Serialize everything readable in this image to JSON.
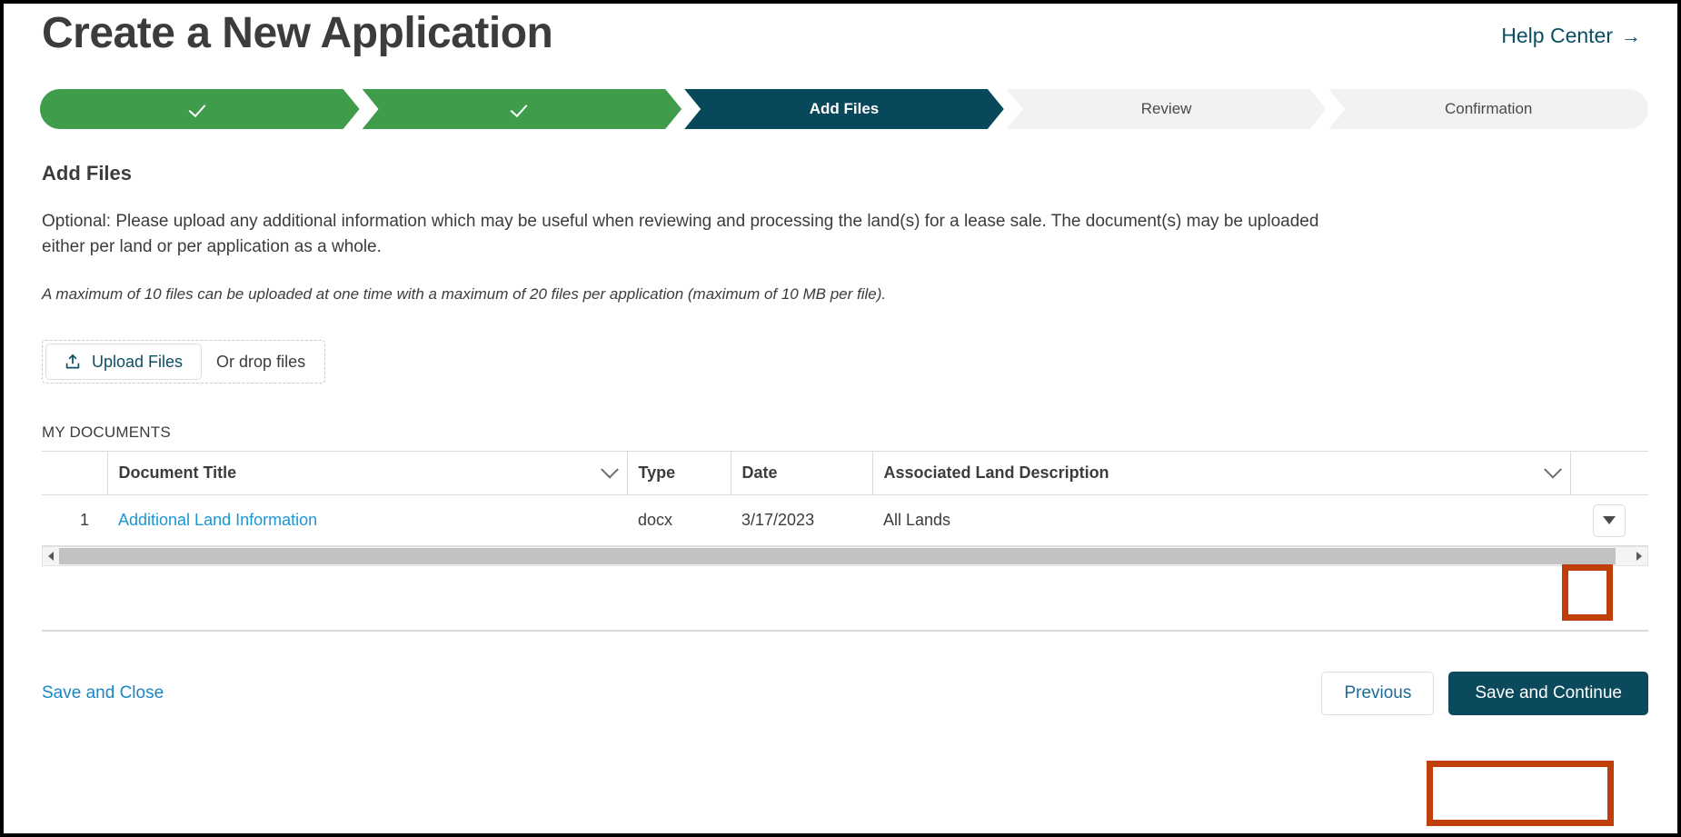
{
  "header": {
    "title": "Create a New Application",
    "help_center": "Help Center",
    "help_center_arrow": "→"
  },
  "progress": {
    "steps": [
      {
        "label": "",
        "state": "done",
        "icon": "check-icon"
      },
      {
        "label": "",
        "state": "done",
        "icon": "check-icon"
      },
      {
        "label": "Add Files",
        "state": "current",
        "icon": ""
      },
      {
        "label": "Review",
        "state": "todo",
        "icon": ""
      },
      {
        "label": "Confirmation",
        "state": "todo",
        "icon": ""
      }
    ]
  },
  "main": {
    "section_title": "Add Files",
    "description": "Optional: Please upload any additional information which may be useful when reviewing and processing the land(s) for a lease sale. The document(s) may be uploaded either per land or per application as a whole.",
    "note": "A maximum of 10 files can be uploaded at one time with a maximum of 20 files per application (maximum of 10 MB per file)."
  },
  "upload": {
    "button_label": "Upload Files",
    "drop_text": "Or drop files",
    "icon": "upload-icon"
  },
  "documents": {
    "label": "MY DOCUMENTS",
    "columns": [
      "",
      "Document Title",
      "Type",
      "Date",
      "Associated Land Description",
      ""
    ],
    "rows": [
      {
        "index": "1",
        "title": "Additional Land Information",
        "type": "docx",
        "date": "3/17/2023",
        "land_description": "All Lands",
        "row_menu_icon": "chevron-down-icon"
      }
    ]
  },
  "scrollbar": {
    "left_arrow": "scroll-left-icon",
    "right_arrow": "scroll-right-icon"
  },
  "footer": {
    "save_and_close": "Save and Close",
    "previous": "Previous",
    "save_and_continue": "Save and Continue"
  },
  "colors": {
    "step_done": "#3f9c4b",
    "step_current": "#08485a",
    "step_todo": "#f2f2f2",
    "primary_button": "#0b4a5c",
    "link_blue": "#1b86c4",
    "doc_link_blue": "#1b96d6",
    "annotation": "#bf3e09",
    "title_gray": "#3c3c3b"
  }
}
